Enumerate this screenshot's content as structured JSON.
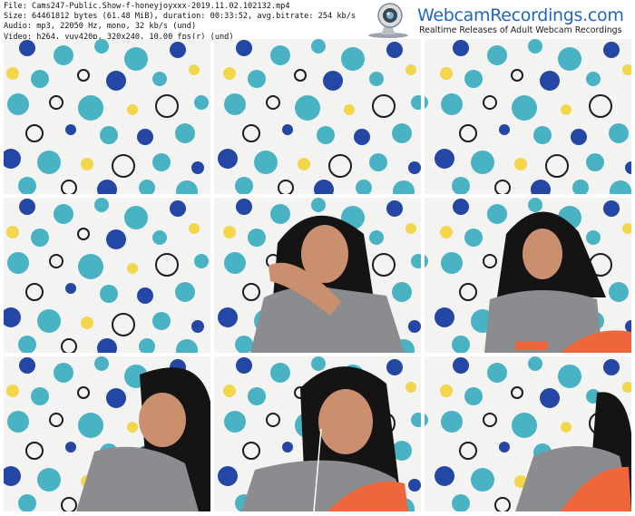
{
  "info": {
    "file": "File: Cams247-Public.Show-f-honeyjoyxxx-2019.11.02.102132.mp4",
    "size": "Size: 64461812 bytes (61.48 MiB), duration: 00:33:52, avg.bitrate: 254 kb/s",
    "audio": "Audio: mp3, 22050 Hz, mono, 32 kb/s (und)",
    "video": "Video: h264, yuv420p, 320x240, 10.00 fps(r) (und)"
  },
  "logo": {
    "brand": "WebcamRecordings.com",
    "tagline": "Realtime Releases of Adult Webcam Recordings"
  },
  "thumbnails": [
    {
      "person": "none"
    },
    {
      "person": "none"
    },
    {
      "person": "none"
    },
    {
      "person": "none"
    },
    {
      "person": "touching-shoulder"
    },
    {
      "person": "sitting-with-phone"
    },
    {
      "person": "looking-down"
    },
    {
      "person": "looking-down-earphones"
    },
    {
      "person": "leaning-edge"
    }
  ],
  "colors": {
    "curtain": "#f3f4f2",
    "teal": "#49b3c4",
    "navy": "#2446a4",
    "yellow": "#f4d64c",
    "dark_ring": "#1a1d22",
    "shirt": "#8b8c8f",
    "skin": "#c98f6e",
    "hair": "#151314",
    "orange": "#f0663c"
  }
}
